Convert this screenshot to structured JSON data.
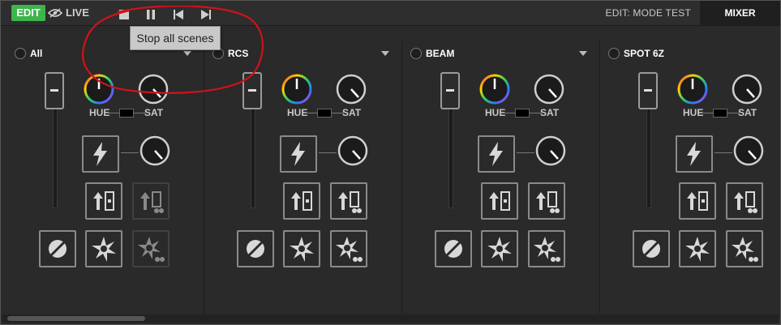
{
  "toolbar": {
    "edit_label": "EDIT",
    "live_label": "LIVE",
    "mode_label": "EDIT: MODE TEST",
    "mixer_label": "MIXER",
    "tooltip": "Stop all scenes"
  },
  "colors": {
    "edit_active": "#3cb54a",
    "annotation": "#d0121b"
  },
  "channels": [
    {
      "name": "All"
    },
    {
      "name": "RCS"
    },
    {
      "name": "BEAM"
    },
    {
      "name": "SPOT 6Z"
    }
  ],
  "labels": {
    "hue": "HUE",
    "sat": "SAT"
  }
}
